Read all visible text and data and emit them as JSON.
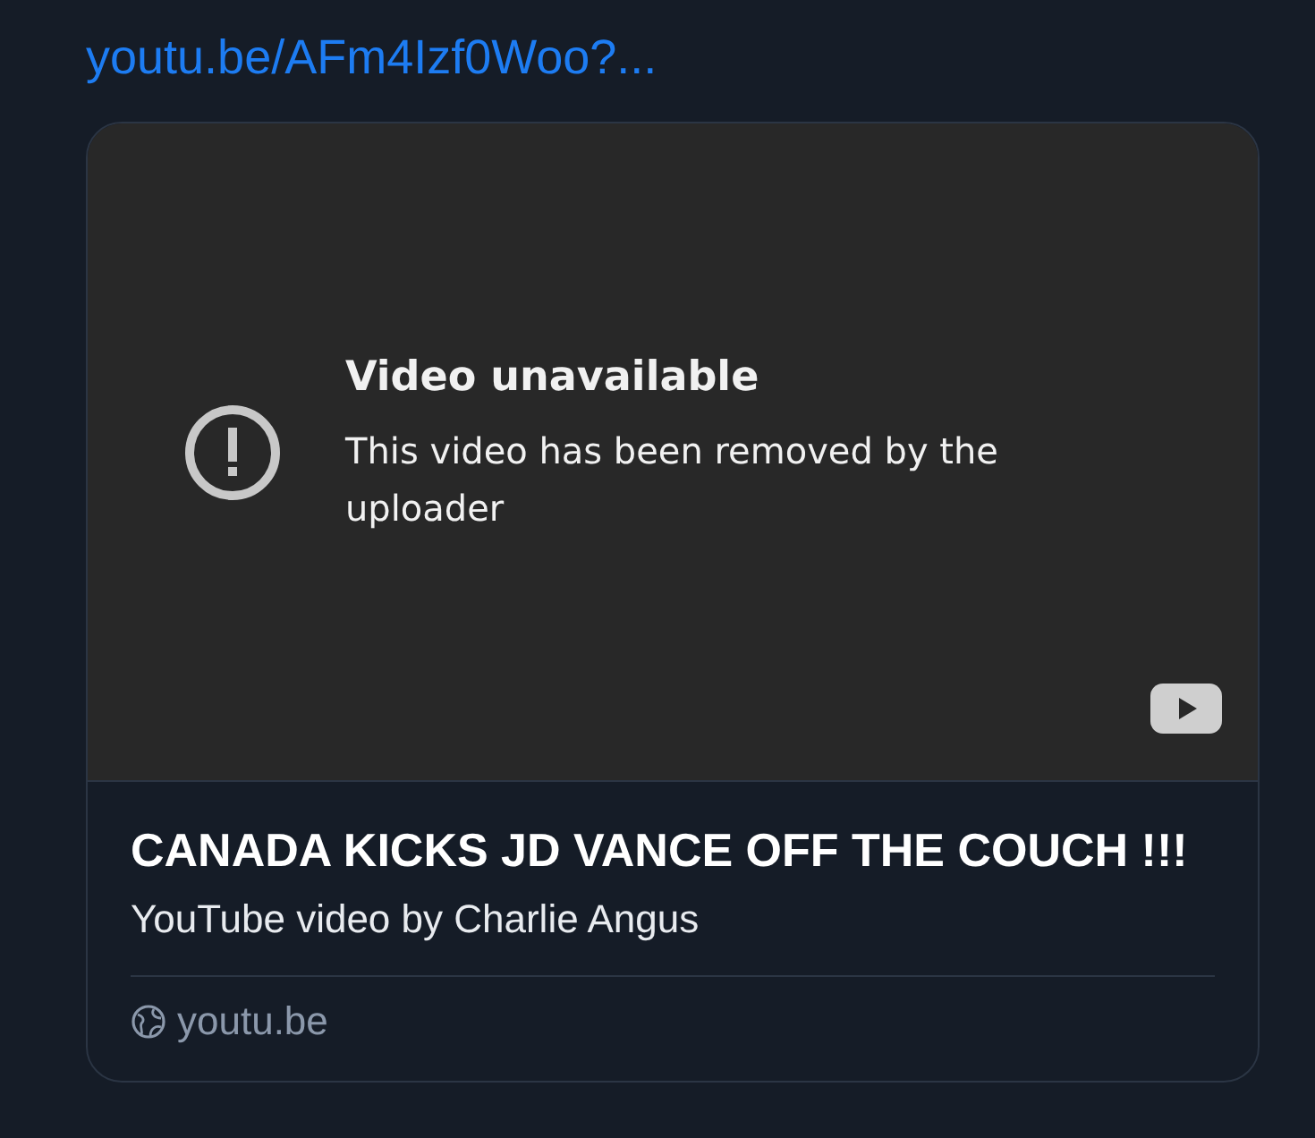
{
  "link": "youtu.be/AFm4Izf0Woo?...",
  "embed": {
    "error_title": "Video unavailable",
    "error_message": "This video has been removed by the uploader"
  },
  "card": {
    "title": "CANADA KICKS JD VANCE OFF THE COUCH !!!",
    "subtitle": "YouTube video by Charlie Angus",
    "domain": "youtu.be"
  }
}
